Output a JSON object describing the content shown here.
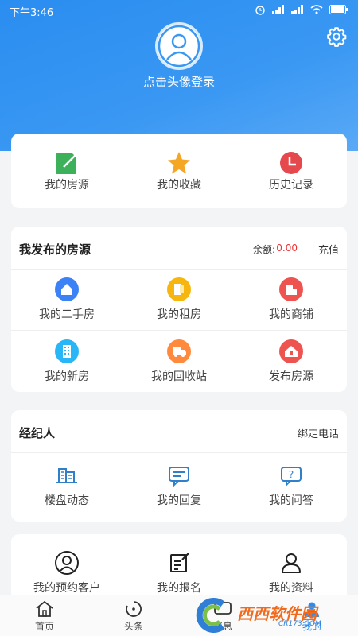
{
  "status_bar": {
    "time": "下午3:46"
  },
  "header": {
    "login_text": "点击头像登录"
  },
  "quick_actions": [
    {
      "label": "我的房源",
      "icon": "edit-square-icon",
      "color": "#3cb15a"
    },
    {
      "label": "我的收藏",
      "icon": "star-icon",
      "color": "#f5a623"
    },
    {
      "label": "历史记录",
      "icon": "clock-icon",
      "color": "#e5484d"
    }
  ],
  "my_listings": {
    "title": "我发布的房源",
    "balance_label": "余额:",
    "balance_value": "0.00",
    "recharge": "充值",
    "items": [
      {
        "label": "我的二手房",
        "icon": "home-icon",
        "color": "#3b82f6"
      },
      {
        "label": "我的租房",
        "icon": "rent-icon",
        "color": "#f6b60e"
      },
      {
        "label": "我的商铺",
        "icon": "shop-icon",
        "color": "#ef5350"
      },
      {
        "label": "我的新房",
        "icon": "building-icon",
        "color": "#29b6f6"
      },
      {
        "label": "我的回收站",
        "icon": "truck-icon",
        "color": "#ff8a3d"
      },
      {
        "label": "发布房源",
        "icon": "publish-house-icon",
        "color": "#ef5350"
      }
    ]
  },
  "agent": {
    "title": "经纪人",
    "bind_phone": "绑定电话",
    "items": [
      {
        "label": "楼盘动态",
        "icon": "buildings-icon"
      },
      {
        "label": "我的回复",
        "icon": "chat-bubble-icon"
      },
      {
        "label": "我的问答",
        "icon": "question-bubble-icon"
      }
    ]
  },
  "personal": {
    "items": [
      {
        "label": "我的预约客户",
        "icon": "user-circle-icon"
      },
      {
        "label": "我的报名",
        "icon": "sign-up-icon"
      },
      {
        "label": "我的资料",
        "icon": "user-profile-icon"
      }
    ]
  },
  "tabs": [
    {
      "label": "首页",
      "icon": "home-tab-icon"
    },
    {
      "label": "头条",
      "icon": "headline-icon"
    },
    {
      "label": "消息",
      "icon": "message-icon"
    },
    {
      "label": "我的",
      "icon": "me-icon"
    }
  ],
  "watermark": {
    "text": "西西软件园",
    "sub": "CR173.COM"
  },
  "colors": {
    "primary": "#2a8df0",
    "accent_icon": "#2f80c8",
    "balance": "#ee3333"
  }
}
